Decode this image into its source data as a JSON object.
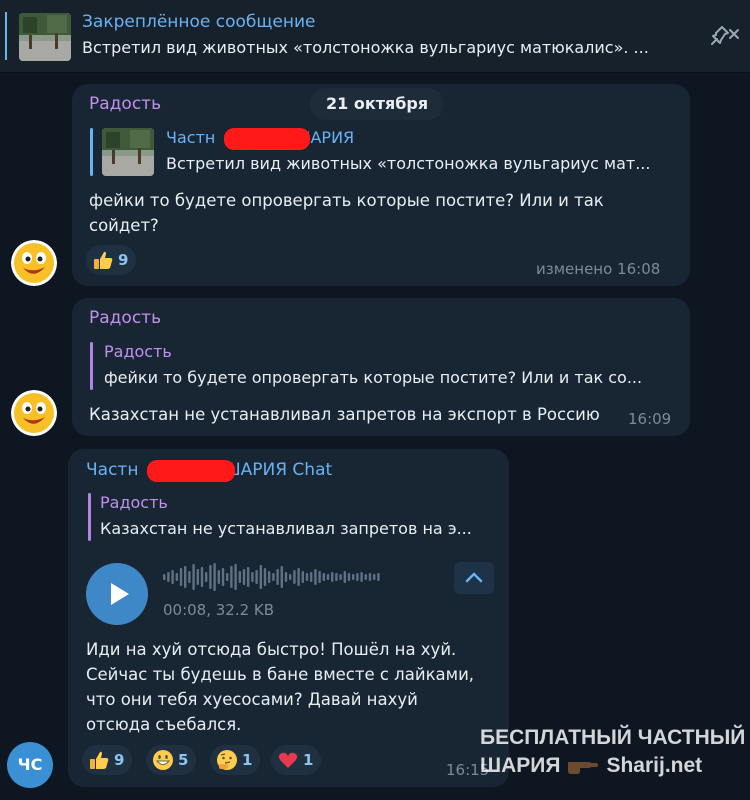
{
  "pinned": {
    "title": "Закреплённое сообщение",
    "text": "Встретил вид животных «толстоножка вульгариус матюкалис».   ..."
  },
  "date_badge": "21 октября",
  "messages": [
    {
      "author": "Радость",
      "reply": {
        "name": "Частн",
        "name_suffix": "ШАРИЯ",
        "text": "Встретил вид животных «толстоножка вульгариус мат..."
      },
      "text": "фейки то будете опровергать которые постите? Или и так\nсойдет?",
      "reactions": [
        {
          "emoji": "thumbs-up",
          "count": "9"
        }
      ],
      "time": "изменено 16:08"
    },
    {
      "author": "Радость",
      "reply": {
        "name": "Радость",
        "text": "фейки то будете опровергать которые постите? Или и так со..."
      },
      "text": "Казахстан не устанавливал запретов на экспорт в Россию",
      "time": "16:09"
    },
    {
      "author": "Частн",
      "author_suffix": "ШАРИЯ Chat",
      "reply": {
        "name": "Радость",
        "text": "Казахстан не устанавливал запретов на э..."
      },
      "voice": {
        "meta": "00:08, 32.2 KB"
      },
      "text": "Иди на хуй отсюда быстро! Пошёл на хуй.\nСейчас ты будешь в бане вместе с лайками,\nчто они тебя хуесосами? Давай нахуй\nотсюда съебался.",
      "reactions": [
        {
          "emoji": "thumbs-up",
          "count": "9"
        },
        {
          "emoji": "grinning-face",
          "count": "5"
        },
        {
          "emoji": "thinking-face",
          "count": "1"
        },
        {
          "emoji": "red-heart",
          "count": "1"
        }
      ],
      "time": "16:15",
      "avatar_initials": "ЧС"
    }
  ],
  "watermark": {
    "line1": "БЕСПЛАТНЫЙ ЧАСТНЫЙ",
    "line2a": "ШАРИЯ",
    "line2b": "Sharij.net"
  },
  "colors": {
    "background": "#0e1621",
    "bubble": "#182533",
    "accent_blue": "#6ab3f3",
    "accent_purple": "#c291ee",
    "redaction": "#ff1919"
  }
}
